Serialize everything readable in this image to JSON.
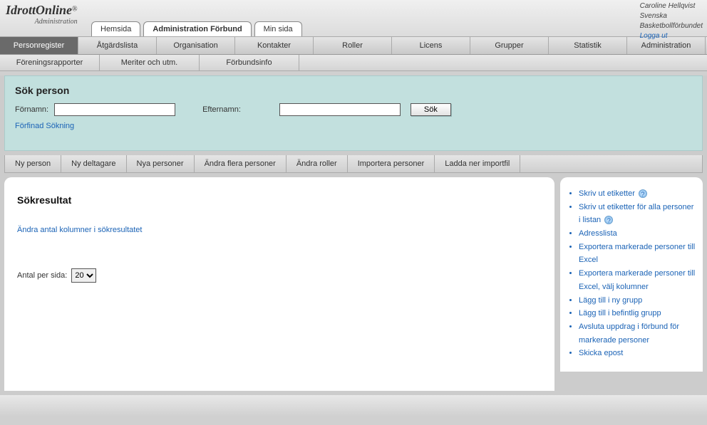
{
  "header": {
    "logo_main": "IdrottOnline",
    "logo_sup": "®",
    "logo_sub": "Administration",
    "user_name": "Caroline Hellqvist",
    "org1": "Svenska",
    "org2": "Basketbollförbundet",
    "logout": "Logga ut"
  },
  "top_tabs": [
    {
      "label": "Hemsida",
      "active": false
    },
    {
      "label": "Administration Förbund",
      "active": true
    },
    {
      "label": "Min sida",
      "active": false
    }
  ],
  "menu": [
    {
      "label": "Personregister",
      "selected": true
    },
    {
      "label": "Åtgärdslista"
    },
    {
      "label": "Organisation"
    },
    {
      "label": "Kontakter"
    },
    {
      "label": "Roller"
    },
    {
      "label": "Licens"
    },
    {
      "label": "Grupper"
    },
    {
      "label": "Statistik"
    },
    {
      "label": "Administration"
    }
  ],
  "submenu": [
    {
      "label": "Föreningsrapporter"
    },
    {
      "label": "Meriter och utm."
    },
    {
      "label": "Förbundsinfo"
    }
  ],
  "search": {
    "title": "Sök person",
    "fname_label": "Förnamn:",
    "lname_label": "Efternamn:",
    "fname_value": "",
    "lname_value": "",
    "button": "Sök",
    "refined": "Förfinad Sökning"
  },
  "actions": [
    "Ny person",
    "Ny deltagare",
    "Nya personer",
    "Ändra flera personer",
    "Ändra roller",
    "Importera personer",
    "Ladda ner importfil"
  ],
  "results": {
    "title": "Sökresultat",
    "change_cols": "Ändra antal kolumner i sökresultatet",
    "per_page_label": "Antal per sida:",
    "per_page_value": "20"
  },
  "side_links": [
    {
      "label": "Skriv ut etiketter",
      "help": true
    },
    {
      "label": "Skriv ut etiketter för alla personer i listan",
      "help": true
    },
    {
      "label": "Adresslista"
    },
    {
      "label": "Exportera markerade personer till Excel"
    },
    {
      "label": "Exportera markerade personer till Excel, välj kolumner"
    },
    {
      "label": "Lägg till i ny grupp"
    },
    {
      "label": "Lägg till i befintlig grupp"
    },
    {
      "label": "Avsluta uppdrag i förbund för markerade personer"
    },
    {
      "label": "Skicka epost"
    }
  ]
}
